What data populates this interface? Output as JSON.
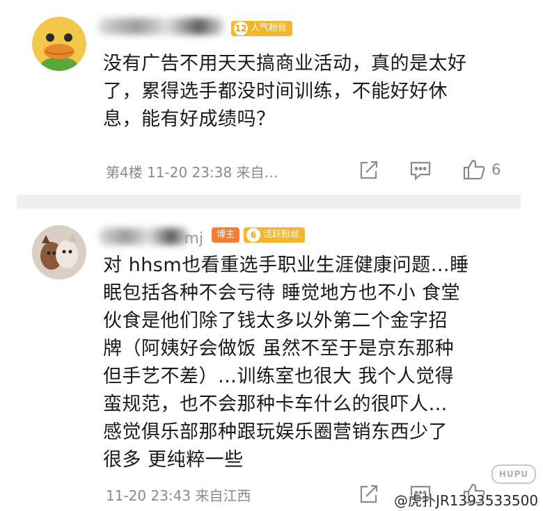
{
  "comments": [
    {
      "fan_badge": {
        "level": "12",
        "label": "人气粉丝"
      },
      "text": "没有广告不用天天搞商业活动，真的是太好\n了，累得选手都没时间训练，不能好好休\n息，能有好成绩吗？",
      "meta": "第4楼  11-20 23:38  来自…",
      "like_count": "6"
    },
    {
      "username_tail": "mj",
      "blogger_badge": "博主",
      "fan_badge": {
        "level": "6",
        "label": "活跃粉丝"
      },
      "text": "对 hhsm也看重选手职业生涯健康问题…睡\n眠包括各种不会亏待 睡觉地方也不小 食堂\n伙食是他们除了钱太多以外第二个金字招\n牌（阿姨好会做饭 虽然不至于是京东那种\n但手艺不差）…训练室也很大 我个人觉得\n蛮规范，也不会那种卡车什么的很吓人…\n感觉俱乐部那种跟玩娱乐圈营销东西少了\n很多 更纯粹一些",
      "meta": "11-20 23:43  来自江西"
    }
  ],
  "watermark": {
    "logo": "HUPU",
    "text": "@虎扑JR1393533500"
  },
  "colors": {
    "badge_gold": "#f7b52c",
    "blogger_orange": "#f07f35",
    "meta_gray": "#8a8a8a"
  },
  "icons": [
    "share-icon",
    "reply-icon",
    "like-icon"
  ]
}
